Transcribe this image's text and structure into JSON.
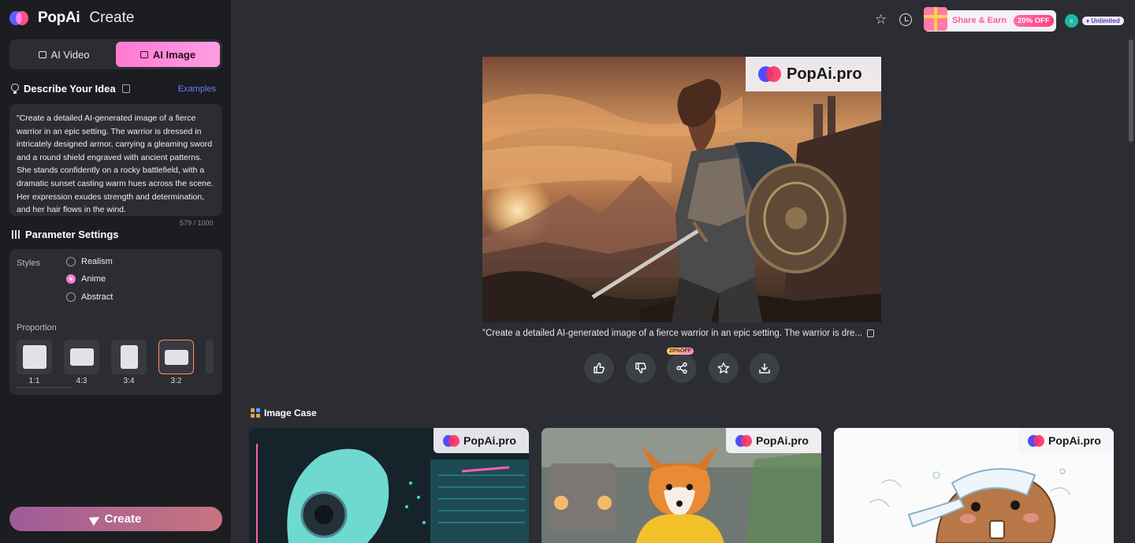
{
  "app": {
    "logo": "PopAi",
    "section": "Create"
  },
  "mode_tabs": [
    {
      "label": "AI Video",
      "active": false
    },
    {
      "label": "AI Image",
      "active": true
    }
  ],
  "describe": {
    "title": "Describe Your Idea",
    "examples_link": "Examples",
    "prompt": "\"Create a detailed AI-generated image of a fierce warrior in an epic setting. The warrior is dressed in intricately designed armor, carrying a gleaming sword and a round shield engraved with ancient patterns. She stands confidently on a rocky battlefield, with a dramatic sunset casting warm hues across the scene. Her expression exudes strength and determination, and her hair flows in the wind.",
    "char_count": "579 / 1000"
  },
  "parameters": {
    "title": "Parameter Settings",
    "styles_label": "Styles",
    "styles": [
      {
        "label": "Realism",
        "checked": false
      },
      {
        "label": "Anime",
        "checked": true
      },
      {
        "label": "Abstract",
        "checked": false
      }
    ],
    "proportion_label": "Proportion",
    "proportions": [
      {
        "label": "1:1",
        "selected": false
      },
      {
        "label": "4:3",
        "selected": false
      },
      {
        "label": "3:4",
        "selected": false
      },
      {
        "label": "3:2",
        "selected": true
      }
    ]
  },
  "create_button": "Create",
  "topbar": {
    "share_earn": "Share & Earn",
    "share_off": "20% OFF",
    "avatar_initial": "c",
    "plan_badge": "Unlimited"
  },
  "result": {
    "watermark": "PopAi.pro",
    "caption": "\"Create a detailed AI-generated image of a fierce warrior in an epic setting. The warrior is dre...",
    "share_badge": "20%OFF",
    "actions": [
      "like-icon",
      "dislike-icon",
      "share-icon",
      "star-icon",
      "download-icon"
    ]
  },
  "image_case": {
    "title": "Image Case",
    "cards": [
      {
        "name": "robot",
        "watermark": "PopAi.pro"
      },
      {
        "name": "fox",
        "watermark": "PopAi.pro"
      },
      {
        "name": "beaver",
        "watermark": "PopAi.pro"
      }
    ]
  },
  "colors": {
    "accent_pink": "#ff7ad1",
    "background": "#2b2d33",
    "sidebar": "#1c1d21",
    "link": "#6f7bff"
  }
}
